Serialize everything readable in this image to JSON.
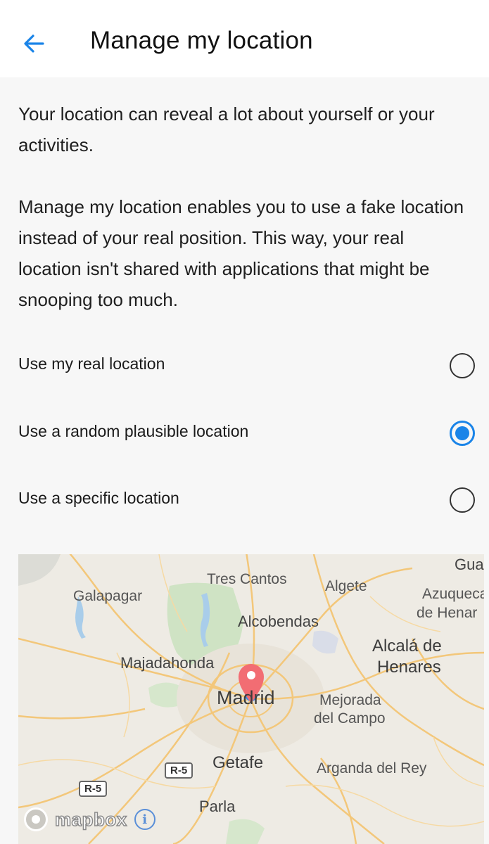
{
  "header": {
    "title": "Manage my location",
    "back_icon": "arrow-left-icon",
    "accent_color": "#1a84e8"
  },
  "intro": {
    "paragraph_1": "Your location can reveal a lot about yourself or your activities.",
    "paragraph_2": "Manage my location enables you to use a fake location instead of your real position. This way, your real location isn't shared with applications that might be snooping too much."
  },
  "options": [
    {
      "label": "Use my real location",
      "selected": false
    },
    {
      "label": "Use a random plausible location",
      "selected": true
    },
    {
      "label": "Use a specific location",
      "selected": false
    }
  ],
  "map": {
    "places": {
      "galapagar": "Galapagar",
      "tres_cantos": "Tres Cantos",
      "algete": "Algete",
      "azuqueca": "Azuqueca",
      "de_henar": "de Henar",
      "gua": "Gua",
      "alcobendas": "Alcobendas",
      "alcala_1": "Alcalá de",
      "alcala_2": "Henares",
      "majadahonda": "Majadahonda",
      "madrid": "Madrid",
      "mejorada_1": "Mejorada",
      "mejorada_2": "del Campo",
      "getafe": "Getafe",
      "arganda": "Arganda del Rey",
      "parla": "Parla"
    },
    "road_shields": [
      "R-5",
      "R-5"
    ],
    "attribution": "mapbox",
    "info_label": "i",
    "pin_color": "#f26d73"
  }
}
